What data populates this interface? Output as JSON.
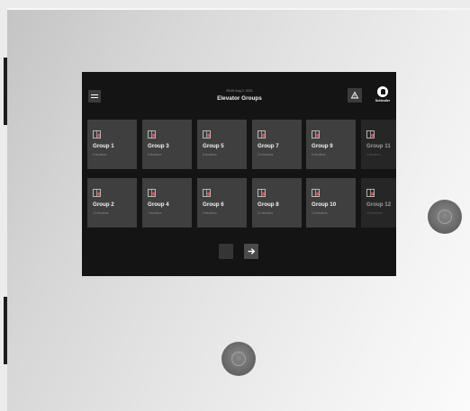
{
  "header": {
    "datetime": "09:45 Aug 2, 2021",
    "title": "Elevator Groups",
    "brand": "Schindler"
  },
  "groups": [
    {
      "label": "Group 1",
      "count": "6 elevators"
    },
    {
      "label": "Group 2",
      "count": "12 elevators"
    },
    {
      "label": "Group 3",
      "count": "6 elevators"
    },
    {
      "label": "Group 4",
      "count": "7 elevators"
    },
    {
      "label": "Group 5",
      "count": "6 elevators"
    },
    {
      "label": "Group 6",
      "count": "9 elevators"
    },
    {
      "label": "Group 7",
      "count": "10 elevators"
    },
    {
      "label": "Group 8",
      "count": "11 elevators"
    },
    {
      "label": "Group 9",
      "count": "6 elevators"
    },
    {
      "label": "Group 10",
      "count": "10 elevators"
    },
    {
      "label": "Group 11",
      "count": "4 elevators"
    },
    {
      "label": "Group 12",
      "count": "10 elevators"
    }
  ],
  "icons": {
    "menu": "menu-icon",
    "alert": "warning-icon",
    "group": "elevator-icon",
    "next": "arrow-right-icon",
    "logo": "schindler-logo"
  },
  "colors": {
    "screen_bg": "#141414",
    "tile_bg": "#3f3f3f",
    "icon_accent": "#e24a5a"
  }
}
